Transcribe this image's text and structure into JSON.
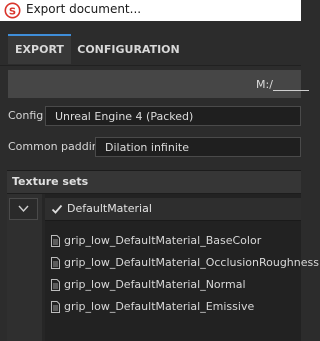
{
  "window": {
    "title": "Export document..."
  },
  "tabs": [
    {
      "label": "EXPORT",
      "active": true
    },
    {
      "label": "CONFIGURATION",
      "active": false
    }
  ],
  "output_path": {
    "value": "M:/"
  },
  "config": {
    "label": "Config",
    "value": "Unreal Engine 4 (Packed)"
  },
  "padding": {
    "label": "Common padding",
    "value": "Dilation infinite"
  },
  "texture_sets": {
    "title": "Texture sets",
    "material": "DefaultMaterial",
    "textures": [
      "grip_low_DefaultMaterial_BaseColor",
      "grip_low_DefaultMaterial_OcclusionRoughnessMe",
      "grip_low_DefaultMaterial_Normal",
      "grip_low_DefaultMaterial_Emissive"
    ]
  },
  "colors": {
    "accent": "#3f8ed9",
    "app_icon": "#d9342b"
  },
  "icons": {
    "app": "substance-logo-icon",
    "collapse": "chevron-down-icon",
    "check": "checkmark-icon",
    "file": "file-icon"
  }
}
